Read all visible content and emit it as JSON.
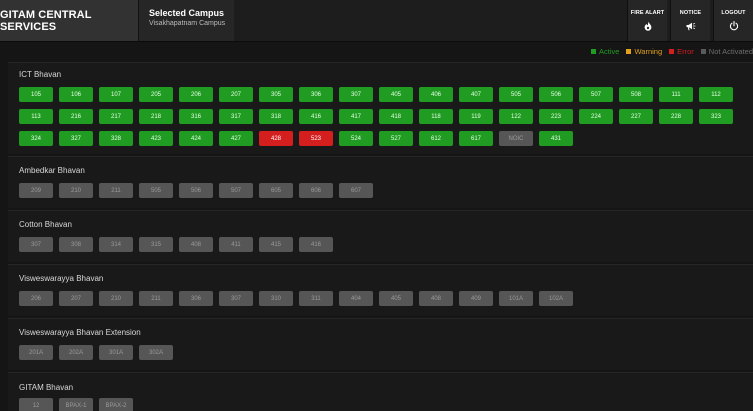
{
  "header": {
    "brand": "GITAM CENTRAL SERVICES",
    "campus_title": "Selected Campus",
    "campus_name": "Visakhapatnam Campus",
    "buttons": [
      {
        "label": "FIRE ALART",
        "icon": "fire-icon"
      },
      {
        "label": "NOTICE",
        "icon": "megaphone-icon"
      },
      {
        "label": "LOGOUT",
        "icon": "power-icon"
      }
    ]
  },
  "legend": [
    {
      "label": "Active",
      "color": "#1f9c21"
    },
    {
      "label": "Warning",
      "color": "#e3a11b"
    },
    {
      "label": "Error",
      "color": "#d51e1e"
    },
    {
      "label": "Not Activated",
      "color": "#5a5a5a"
    }
  ],
  "buildings": [
    {
      "name": "ICT Bhavan",
      "rooms": [
        {
          "n": "105",
          "s": "active"
        },
        {
          "n": "106",
          "s": "active"
        },
        {
          "n": "107",
          "s": "active"
        },
        {
          "n": "205",
          "s": "active"
        },
        {
          "n": "206",
          "s": "active"
        },
        {
          "n": "207",
          "s": "active"
        },
        {
          "n": "305",
          "s": "active"
        },
        {
          "n": "306",
          "s": "active"
        },
        {
          "n": "307",
          "s": "active"
        },
        {
          "n": "405",
          "s": "active"
        },
        {
          "n": "406",
          "s": "active"
        },
        {
          "n": "407",
          "s": "active"
        },
        {
          "n": "505",
          "s": "active"
        },
        {
          "n": "506",
          "s": "active"
        },
        {
          "n": "507",
          "s": "active"
        },
        {
          "n": "508",
          "s": "active"
        },
        {
          "n": "111",
          "s": "active"
        },
        {
          "n": "112",
          "s": "active"
        },
        {
          "n": "113",
          "s": "active"
        },
        {
          "n": "216",
          "s": "active"
        },
        {
          "n": "217",
          "s": "active"
        },
        {
          "n": "218",
          "s": "active"
        },
        {
          "n": "316",
          "s": "active"
        },
        {
          "n": "317",
          "s": "active"
        },
        {
          "n": "318",
          "s": "active"
        },
        {
          "n": "416",
          "s": "active"
        },
        {
          "n": "417",
          "s": "active"
        },
        {
          "n": "418",
          "s": "active"
        },
        {
          "n": "118",
          "s": "active"
        },
        {
          "n": "119",
          "s": "active"
        },
        {
          "n": "122",
          "s": "active"
        },
        {
          "n": "223",
          "s": "active"
        },
        {
          "n": "224",
          "s": "active"
        },
        {
          "n": "227",
          "s": "active"
        },
        {
          "n": "228",
          "s": "active"
        },
        {
          "n": "323",
          "s": "active"
        },
        {
          "n": "324",
          "s": "active"
        },
        {
          "n": "327",
          "s": "active"
        },
        {
          "n": "328",
          "s": "active"
        },
        {
          "n": "423",
          "s": "active"
        },
        {
          "n": "424",
          "s": "active"
        },
        {
          "n": "427",
          "s": "active"
        },
        {
          "n": "428",
          "s": "error"
        },
        {
          "n": "523",
          "s": "error"
        },
        {
          "n": "524",
          "s": "active"
        },
        {
          "n": "527",
          "s": "active"
        },
        {
          "n": "612",
          "s": "active"
        },
        {
          "n": "617",
          "s": "active"
        },
        {
          "n": "NOIC",
          "s": "inactive"
        },
        {
          "n": "431",
          "s": "active"
        }
      ]
    },
    {
      "name": "Ambedkar Bhavan",
      "rooms": [
        {
          "n": "209",
          "s": "inactive"
        },
        {
          "n": "210",
          "s": "inactive"
        },
        {
          "n": "211",
          "s": "inactive"
        },
        {
          "n": "505",
          "s": "inactive"
        },
        {
          "n": "506",
          "s": "inactive"
        },
        {
          "n": "507",
          "s": "inactive"
        },
        {
          "n": "605",
          "s": "inactive"
        },
        {
          "n": "606",
          "s": "inactive"
        },
        {
          "n": "607",
          "s": "inactive"
        }
      ]
    },
    {
      "name": "Cotton Bhavan",
      "rooms": [
        {
          "n": "307",
          "s": "inactive"
        },
        {
          "n": "308",
          "s": "inactive"
        },
        {
          "n": "314",
          "s": "inactive"
        },
        {
          "n": "315",
          "s": "inactive"
        },
        {
          "n": "408",
          "s": "inactive"
        },
        {
          "n": "411",
          "s": "inactive"
        },
        {
          "n": "415",
          "s": "inactive"
        },
        {
          "n": "416",
          "s": "inactive"
        }
      ]
    },
    {
      "name": "Visweswarayya Bhavan",
      "rooms": [
        {
          "n": "206",
          "s": "inactive"
        },
        {
          "n": "207",
          "s": "inactive"
        },
        {
          "n": "210",
          "s": "inactive"
        },
        {
          "n": "211",
          "s": "inactive"
        },
        {
          "n": "306",
          "s": "inactive"
        },
        {
          "n": "307",
          "s": "inactive"
        },
        {
          "n": "310",
          "s": "inactive"
        },
        {
          "n": "311",
          "s": "inactive"
        },
        {
          "n": "404",
          "s": "inactive"
        },
        {
          "n": "405",
          "s": "inactive"
        },
        {
          "n": "408",
          "s": "inactive"
        },
        {
          "n": "409",
          "s": "inactive"
        },
        {
          "n": "101A",
          "s": "inactive"
        },
        {
          "n": "102A",
          "s": "inactive"
        }
      ]
    },
    {
      "name": "Visweswarayya Bhavan Extension",
      "rooms": [
        {
          "n": "201A",
          "s": "inactive"
        },
        {
          "n": "202A",
          "s": "inactive"
        },
        {
          "n": "301A",
          "s": "inactive"
        },
        {
          "n": "302A",
          "s": "inactive"
        }
      ]
    },
    {
      "name": "GITAM Bhavan",
      "rooms": [
        {
          "n": "12",
          "s": "inactive"
        },
        {
          "n": "BPAX-1",
          "s": "inactive"
        },
        {
          "n": "BPAX-2",
          "s": "inactive"
        }
      ]
    }
  ]
}
